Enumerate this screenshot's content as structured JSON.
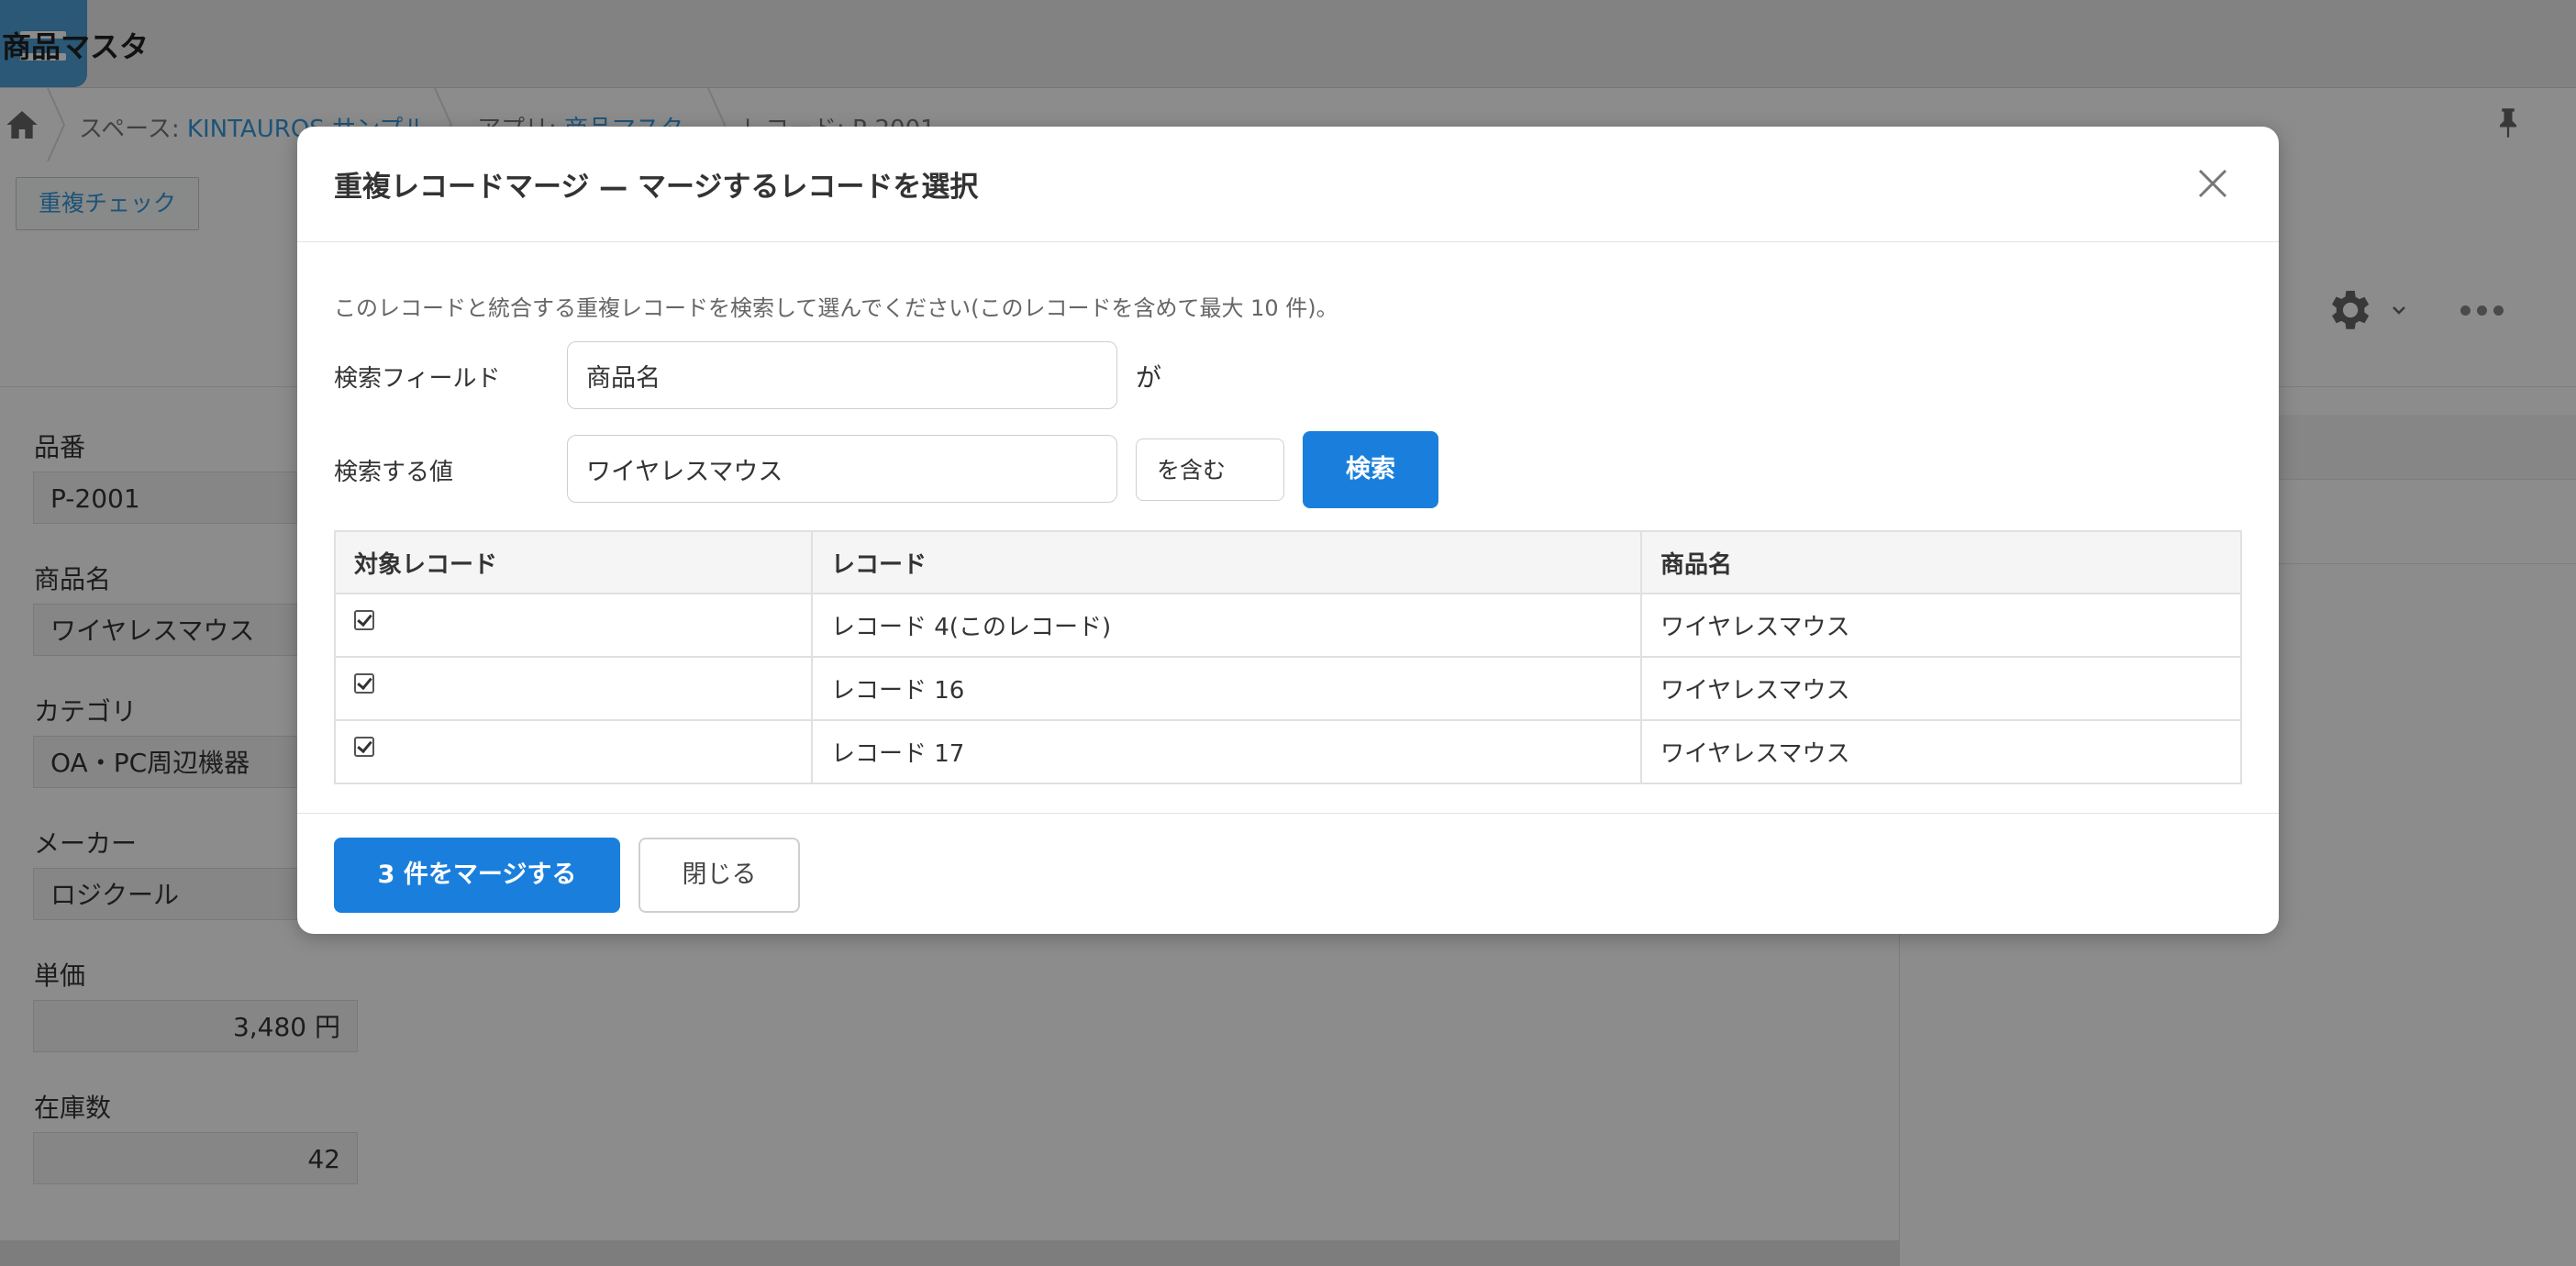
{
  "app": {
    "title": "商品マスタ"
  },
  "breadcrumb": {
    "space_prefix": "スペース: ",
    "space_name": "KINTAUROS サンプル",
    "app_prefix": "アプリ: ",
    "app_name": "商品マスタ",
    "record_label": "レコード: P-2001"
  },
  "toolbar": {
    "duplicate_check_label": "重複チェック"
  },
  "form": {
    "fields": [
      {
        "label": "品番",
        "value": "P-2001"
      },
      {
        "label": "商品名",
        "value": "ワイヤレスマウス"
      },
      {
        "label": "カテゴリ",
        "value": "OA・PC周辺機器"
      },
      {
        "label": "メーカー",
        "value": "ロジクール"
      },
      {
        "label": "単価",
        "value": "3,480 円"
      },
      {
        "label": "在庫数",
        "value": "42"
      }
    ]
  },
  "dialog": {
    "title": "重複レコードマージ — マージするレコードを選択",
    "description": "このレコードと統合する重複レコードを検索して選んでください(このレコードを含めて最大 10 件)。",
    "search_field_label": "検索フィールド",
    "search_field_value": "商品名",
    "ga_label": "が",
    "search_value_label": "検索する値",
    "search_value": "ワイヤレスマウス",
    "operator": "を含む",
    "search_button": "検索",
    "table": {
      "headers": [
        "対象レコード",
        "レコード",
        "商品名"
      ],
      "rows": [
        {
          "checked": true,
          "record": "レコード 4(このレコード)",
          "name": "ワイヤレスマウス"
        },
        {
          "checked": true,
          "record": "レコード 16",
          "name": "ワイヤレスマウス"
        },
        {
          "checked": true,
          "record": "レコード 17",
          "name": "ワイヤレスマウス"
        }
      ]
    },
    "merge_button": "3 件をマージする",
    "close_button": "閉じる"
  },
  "colors": {
    "primary": "#1a7fdc",
    "link": "#3498db",
    "overlay": "rgba(0,0,0,0.45)"
  }
}
